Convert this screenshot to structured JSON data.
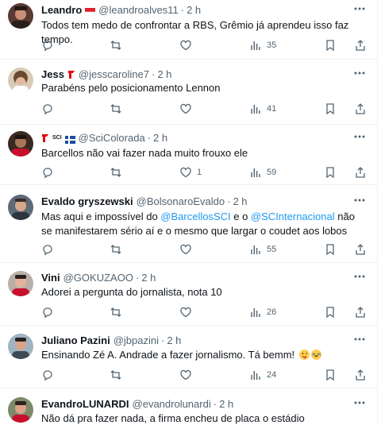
{
  "replies": [
    {
      "name": "Leandro",
      "handle": "@leandroalves11",
      "time": "2 h",
      "text": "Todos tem medo de confrontar a RBS, Grêmio já aprendeu isso faz tempo.",
      "views": "35",
      "likes": ""
    },
    {
      "name": "Jess",
      "handle": "@jesscaroline7",
      "time": "2 h",
      "text": "Parabéns pelo posicionamento Lennon",
      "views": "41",
      "likes": ""
    },
    {
      "name": "SCI",
      "handle": "@SciColorada",
      "time": "2 h",
      "text": "Barcellos não vai fazer nada muito frouxo ele",
      "views": "59",
      "likes": "1"
    },
    {
      "name": "Evaldo gryszewski",
      "handle": "@BolsonaroEvaldo",
      "time": "2 h",
      "text_a": "Mas aqui e impossível do ",
      "mention_1": "@BarcellosSCI",
      "text_b": " e o ",
      "mention_2": "@SCInternacional",
      "text_c": " não se manifestarem sério aí e o mesmo que largar o coudet aos lobos",
      "views": "55",
      "likes": ""
    },
    {
      "name": "Vini",
      "handle": "@GOKUZAOO",
      "time": "2 h",
      "text": "Adorei a pergunta do jornalista, nota 10",
      "views": "26",
      "likes": ""
    },
    {
      "name": "Juliano Pazini",
      "handle": "@jbpazini",
      "time": "2 h",
      "text": "Ensinando Zé A. Andrade a fazer jornalismo. Tá bemm!",
      "views": "24",
      "likes": ""
    },
    {
      "name": "EvandroLUNARDI",
      "handle": "@evandrolunardi",
      "time": "2 h",
      "text": "Não dá pra fazer nada, a firma encheu de placa o estádio",
      "views": "",
      "likes": ""
    }
  ],
  "dot": "·",
  "colors": {
    "accent": "#1d9bf0",
    "muted": "#536471",
    "text": "#0f1419",
    "divider": "#eff3f4",
    "inter_red": "#e5050f"
  },
  "icons": [
    "more-icon",
    "reply-icon",
    "retweet-icon",
    "like-icon",
    "views-icon",
    "bookmark-icon",
    "share-icon"
  ]
}
